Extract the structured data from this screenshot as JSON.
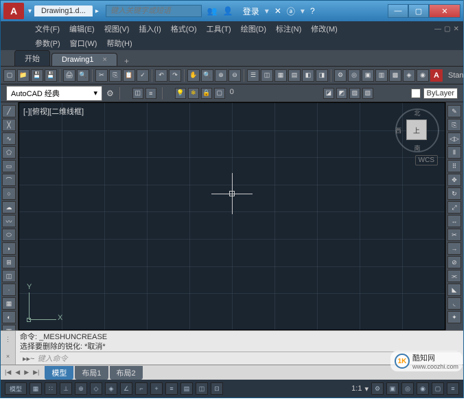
{
  "title": {
    "app_icon": "A",
    "file_tab": "Drawing1.d...",
    "search_placeholder": "键入关键字或短语",
    "login": "登录"
  },
  "win": {
    "min": "—",
    "max": "▢",
    "close": "✕"
  },
  "menu1": [
    "文件(F)",
    "编辑(E)",
    "视图(V)",
    "插入(I)",
    "格式(O)",
    "工具(T)",
    "绘图(D)",
    "标注(N)",
    "修改(M)"
  ],
  "menu2": [
    "参数(P)",
    "窗口(W)",
    "帮助(H)"
  ],
  "doc_tabs": {
    "start": "开始",
    "drawing": "Drawing1",
    "add": "+"
  },
  "workspace": {
    "name": "AutoCAD 经典",
    "arrow": "▾"
  },
  "bylayer": "ByLayer",
  "zero": "0",
  "viewport_label": "[-][俯视][二维线框]",
  "viewcube": {
    "face": "上",
    "wcs": "WCS"
  },
  "ucs": {
    "x": "X",
    "y": "Y"
  },
  "command": {
    "line1": "命令:  _MESHUNCREASE",
    "line2": "选择要删除的锐化: *取消*",
    "prompt": "▸▸~",
    "input_placeholder": "键入命令"
  },
  "layout": {
    "model": "模型",
    "l1": "布局1",
    "l2": "布局2"
  },
  "status": {
    "scale": "1:1",
    "model_btn": "模型"
  },
  "stan": "Stan",
  "a_swatch": "A",
  "watermark": {
    "logo": "1K",
    "name": "酷知网",
    "url": "www.coozhi.com"
  }
}
